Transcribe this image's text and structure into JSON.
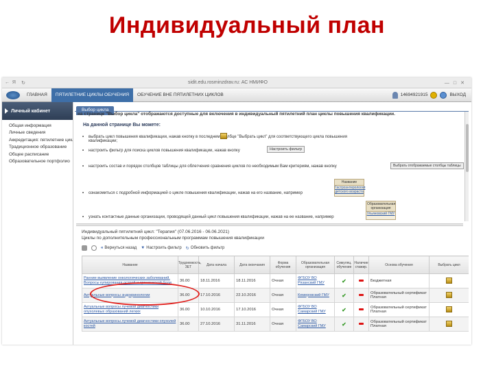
{
  "slide": {
    "title": "Индивидуальный план"
  },
  "browser": {
    "url": "sidit.edu.rosminzdrav.ru: АС НМИФО"
  },
  "header": {
    "menu": [
      "ГЛАВНАЯ",
      "ПЯТИЛЕТНИЕ ЦИКЛЫ ОБУЧЕНИЯ",
      "ОБУЧЕНИЕ ВНЕ ПЯТИЛЕТНИХ ЦИКЛОВ"
    ],
    "user_id": "14694921915",
    "exit": "ВЫХОД"
  },
  "sidebar": {
    "title": "Личный кабинет",
    "items": [
      "Общая информация",
      "Личные сведения",
      "Аккредитация: пятилетние цикл",
      "Традиционное образование",
      "Общее расписание",
      "Образовательное портфолио"
    ]
  },
  "tab": "Выбор цикла",
  "info": {
    "top": "на странице \"Выбор цикла\" отображаются доступные для включения в индивидуальный пятилетний план циклы повышения квалификации.",
    "heading": "На данной странице Вы можете:",
    "bullets": [
      "выбрать цикл повышения квалификации, нажав кнопку       в последнем столбце \"Выбрать цикл\" для соответствующего цикла повышения квалификации;",
      "настроить фильтр для поиска циклов повышения квалификации, нажав кнопку",
      "настроить состав и порядок столбцов таблицы для облегчения сравнения циклов по необходимым Вам критериям, нажав кнопку",
      "ознакомиться с подробной информацией о цикле повышения квалификации, нажав на его название, например",
      "узнать контактные данные организации, проводящей данный цикл повышения квалификации, нажав на ее название, например"
    ],
    "btn_filter": "Настроить фильтр",
    "btn_columns": "Выбрать отображаемые столбцы таблицы",
    "pop1_title": "Название",
    "pop1_link": "Гастроэнтерология детского возраста",
    "pop2_title": "Образовательная организация",
    "pop2_link": "Ульяновский ГМУ"
  },
  "plan": {
    "title": "Индивидуальный пятилетний цикл: \"Терапия\" (07.06.2016 - 06.06.2021)",
    "subtitle": "Циклы по дополнительным профессиональным программам повышения квалификации"
  },
  "toolbar": {
    "back": "Вернуться назад",
    "filter": "Настроить фильтр",
    "refresh": "Обновить фильтр"
  },
  "table": {
    "headers": [
      "Название",
      "Трудоемкость, ЗЕТ",
      "Дата начала",
      "Дата окончания",
      "Форма обучения",
      "Образовательная организация",
      "Симуляц. обучение",
      "Наличие стажир.",
      "Основа обучения",
      "Выбрать цикл"
    ],
    "rows": [
      [
        "Ранние выявление онкологических заболеваний. Вопросы купирования острой и хронической боли",
        "36.00",
        "18.11.2016",
        "18.11.2016",
        "Очная",
        "ФГБОУ ВО Рязанский ГМУ",
        "Бюджетная"
      ],
      [
        "Актуальные вопросы эндокринологии",
        "36.00",
        "17.10.2016",
        "22.10.2016",
        "Очная",
        "Кемеровский ГМУ",
        "Образовательный сертификат Платная"
      ],
      [
        "Актуальные вопросы лучевой диагностики опухолевых образований легких",
        "36.00",
        "10.10.2016",
        "17.10.2016",
        "Очная",
        "ФГБОУ ВО Самарский ГМУ",
        "Образовательный сертификат Платная"
      ],
      [
        "Актуальные вопросы лучевой диагностики опухолей костей",
        "36.00",
        "27.10.2016",
        "31.11.2016",
        "Очная",
        "ФГБОУ ВО Самарский ГМУ",
        "Образовательный сертификат Платная"
      ]
    ]
  },
  "colors": {
    "title": "#c00000",
    "accent": "#3e6fa8",
    "link": "#2a57a3",
    "highlight_oval": "#e0201d"
  }
}
